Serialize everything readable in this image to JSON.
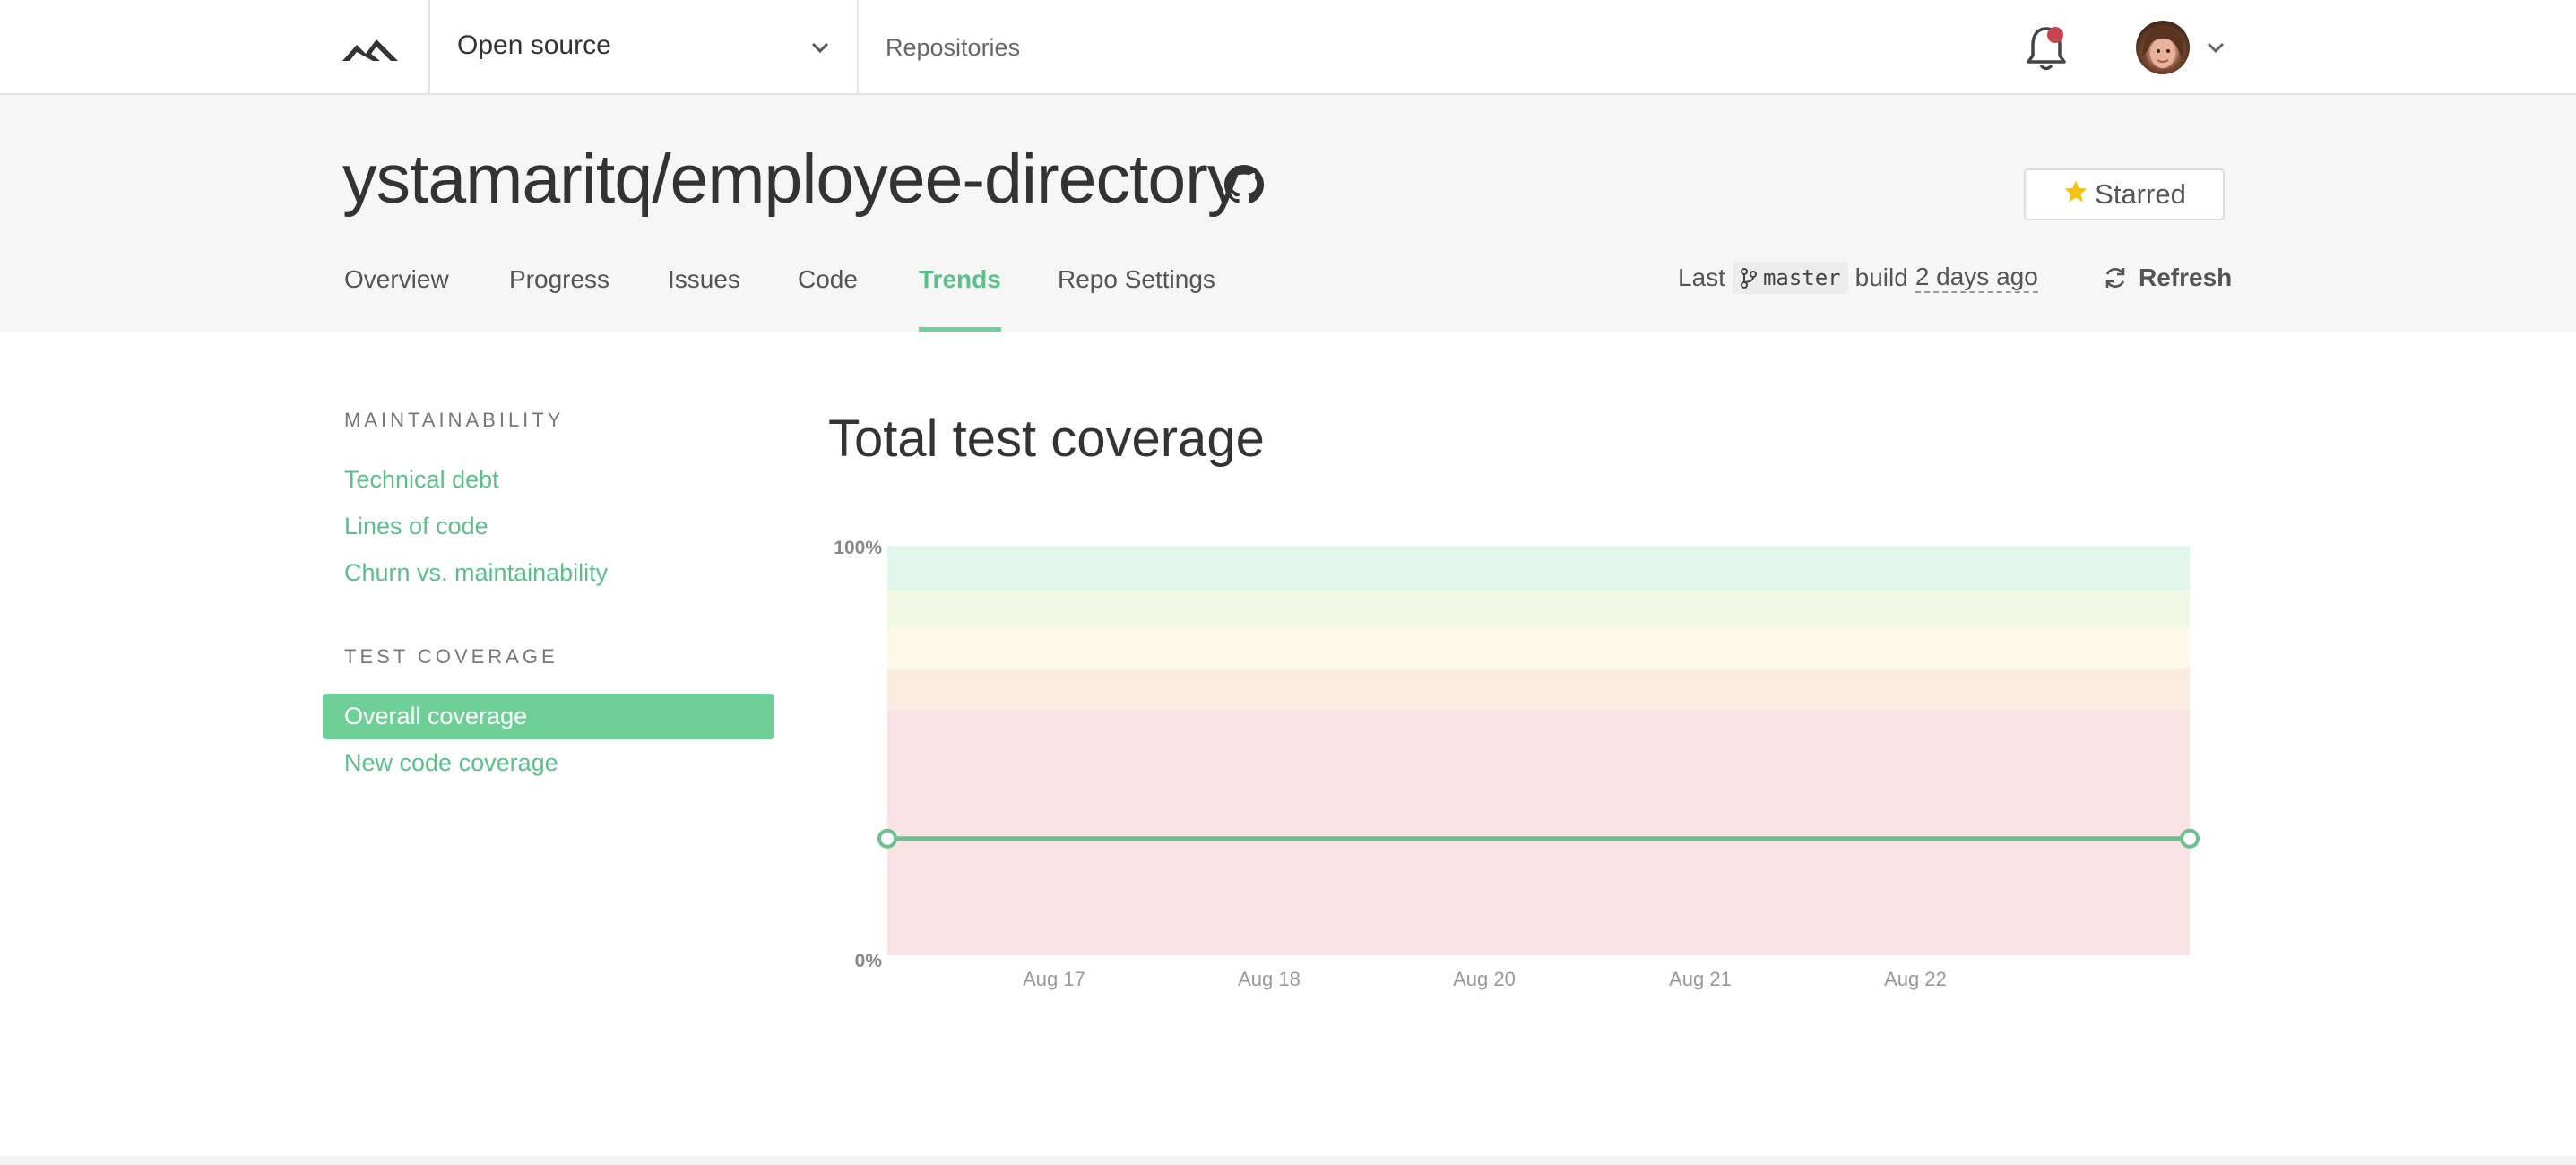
{
  "topbar": {
    "org_name": "Open source",
    "repositories_link": "Repositories",
    "notification_color": "#c94452"
  },
  "repo": {
    "title": "ystamaritq/employee-directory",
    "starred_label": "Starred"
  },
  "tabs": [
    {
      "label": "Overview",
      "active": false
    },
    {
      "label": "Progress",
      "active": false
    },
    {
      "label": "Issues",
      "active": false
    },
    {
      "label": "Code",
      "active": false
    },
    {
      "label": "Trends",
      "active": true
    },
    {
      "label": "Repo Settings",
      "active": false
    }
  ],
  "build": {
    "prefix": "Last",
    "branch": "master",
    "middle": "build",
    "ago": "2 days ago",
    "refresh_label": "Refresh"
  },
  "sidebar": {
    "maintainability_heading": "MAINTAINABILITY",
    "maintainability_items": [
      "Technical debt",
      "Lines of code",
      "Churn vs. maintainability"
    ],
    "coverage_heading": "TEST COVERAGE",
    "coverage_items": [
      "Overall coverage",
      "New code coverage"
    ],
    "active_item": "Overall coverage"
  },
  "main": {
    "title": "Total test coverage"
  },
  "colors": {
    "accent": "#6ecf97",
    "line": "#6cbf8f",
    "bands": [
      "#f8e3e4",
      "#faeadf",
      "#fcf9ea",
      "#f1f8e5",
      "#e3f6ec"
    ]
  },
  "chart_data": {
    "type": "line",
    "title": "Total test coverage",
    "xlabel": "",
    "ylabel": "",
    "y_tick_labels": [
      "100%",
      "0%"
    ],
    "ylim": [
      0,
      100
    ],
    "x_tick_labels": [
      "Aug 17",
      "Aug 18",
      "Aug 20",
      "Aug 21",
      "Aug 22"
    ],
    "background_bands": [
      {
        "from": 0,
        "to": 60
      },
      {
        "from": 60,
        "to": 70
      },
      {
        "from": 70,
        "to": 80
      },
      {
        "from": 80,
        "to": 89
      },
      {
        "from": 89,
        "to": 100
      }
    ],
    "series": [
      {
        "points": [
          {
            "x": 0,
            "y": 28.5
          },
          {
            "x": 1,
            "y": 28.5
          }
        ]
      }
    ],
    "grid": false,
    "legend": "none"
  }
}
